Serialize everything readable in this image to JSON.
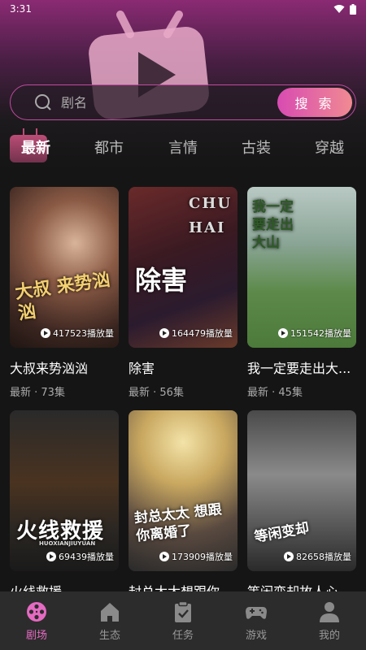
{
  "status_bar": {
    "time": "3:31"
  },
  "search": {
    "placeholder": "剧名",
    "button_label": "搜 索"
  },
  "tabs": [
    {
      "label": "最新",
      "active": true
    },
    {
      "label": "都市",
      "active": false
    },
    {
      "label": "言情",
      "active": false
    },
    {
      "label": "古装",
      "active": false
    },
    {
      "label": "穿越",
      "active": false
    }
  ],
  "dramas": [
    {
      "title": "大叔来势汹汹",
      "poster_text": "大叔 来势汹汹",
      "plays": "417523播放量",
      "meta": "最新 · 73集"
    },
    {
      "title": "除害",
      "poster_text": "除害",
      "poster_side_text": "CHU HAI",
      "plays": "164479播放量",
      "meta": "最新 · 56集"
    },
    {
      "title": "我一定要走出大...",
      "poster_text": "我一定要走出大山",
      "plays": "151542播放量",
      "meta": "最新 · 45集"
    },
    {
      "title": "火线救援",
      "poster_text": "火线救援",
      "poster_subtext": "HUOXIANJIUYUAN",
      "plays": "69439播放量",
      "meta": ""
    },
    {
      "title": "封总太太想跟你...",
      "poster_text": "封总太太 想跟你离婚了",
      "plays": "173909播放量",
      "meta": ""
    },
    {
      "title": "等闲变却故人心",
      "poster_text": "等闲变却",
      "plays": "82658播放量",
      "meta": ""
    }
  ],
  "bottom_nav": [
    {
      "label": "剧场",
      "icon": "film-reel-icon",
      "active": true
    },
    {
      "label": "生态",
      "icon": "home-icon",
      "active": false
    },
    {
      "label": "任务",
      "icon": "clipboard-check-icon",
      "active": false
    },
    {
      "label": "游戏",
      "icon": "gamepad-icon",
      "active": false
    },
    {
      "label": "我的",
      "icon": "user-icon",
      "active": false
    }
  ],
  "colors": {
    "accent": "#e56ac1",
    "search_button_start": "#d84bb2",
    "search_button_end": "#f08a92",
    "header_top": "#8a2a73",
    "background": "#151515",
    "nav_bg": "#2c2c2c"
  }
}
